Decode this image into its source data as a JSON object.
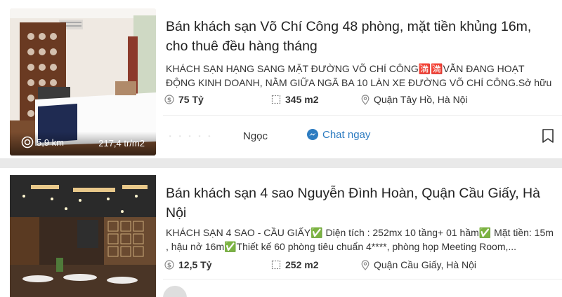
{
  "listings": [
    {
      "title": "Bán khách sạn Võ Chí Công 48 phòng, mặt tiền khủng 16m, cho thuê đều hàng tháng",
      "description": "KHÁCH SẠN HẠNG SANG MẶT ĐƯỜNG VÕ CHÍ CÔNG🈵🈵VẪN ĐANG HOẠT ĐỘNG KINH DOANH, NẰM GIỮA NGÃ BA 10 LÀN XE ĐƯỜNG VÕ CHÍ CÔNG.Sở hữu mặt tiền...",
      "price": "75 Tỷ",
      "area": "345 m2",
      "location": "Quận Tây Hồ, Hà Nội",
      "distance": "5,9 km",
      "price_per_m2": "217,4 tr/m2",
      "contact_blurred": "· · · · ·",
      "agent_name": "Ngọc",
      "chat_label": "Chat ngay"
    },
    {
      "title": "Bán khách sạn 4 sao Nguyễn Đình Hoàn, Quận Cầu Giấy, Hà Nội",
      "description": "KHÁCH SẠN 4 SAO - CẦU GIẤY✅ Diện tích : 252mx 10 tầng+ 01 hầm✅ Mặt tiền: 15m , hậu nở 16m✅Thiết kế 60 phòng tiêu chuẩn 4****, phòng họp Meeting Room,...",
      "price": "12,5 Tỷ",
      "area": "252 m2",
      "location": "Quận Cầu Giấy, Hà Nội"
    }
  ],
  "colors": {
    "accent": "#2d7cc1",
    "background": "#e9e9e9",
    "card": "#ffffff"
  },
  "icons": {
    "price": "coin-icon",
    "area": "area-icon",
    "location": "location-pin-icon",
    "chat": "messenger-icon",
    "save": "bookmark-icon",
    "distance": "target-icon"
  }
}
